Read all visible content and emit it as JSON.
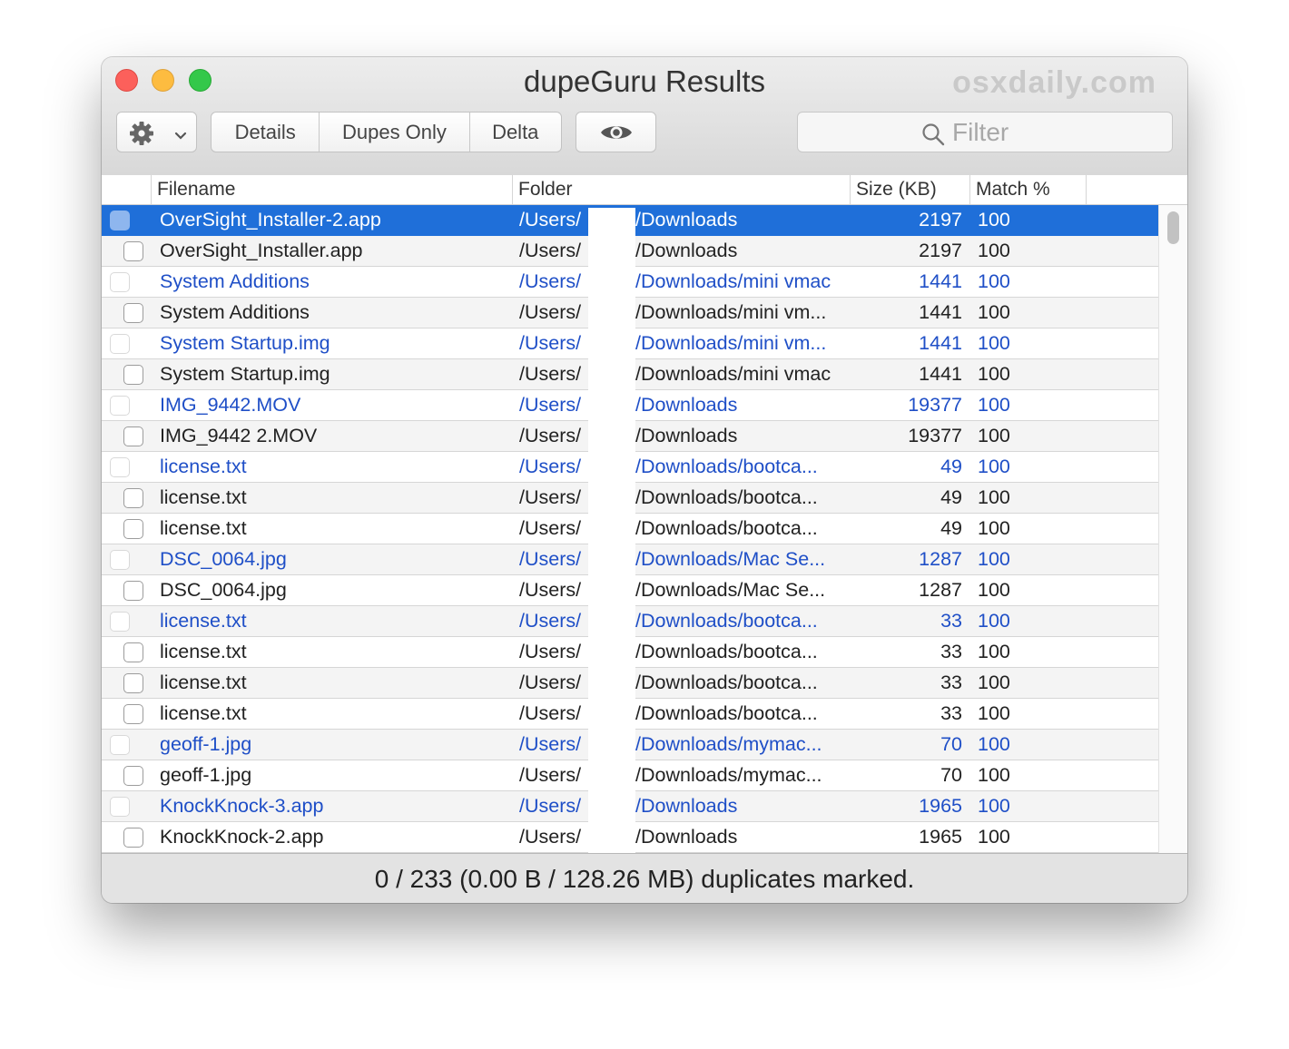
{
  "window": {
    "title": "dupeGuru Results",
    "watermark": "osxdaily.com"
  },
  "toolbar": {
    "gear_icon": "gear-icon",
    "view_buttons": [
      {
        "label": "Details"
      },
      {
        "label": "Dupes Only"
      },
      {
        "label": "Delta"
      }
    ],
    "preview_icon": "eye-icon",
    "filter_placeholder": "Filter"
  },
  "table": {
    "columns": [
      "Filename",
      "Folder",
      "Size (KB)",
      "Match %"
    ],
    "rows": [
      {
        "name": "OverSight_Installer-2.app",
        "folder_prefix": "/Users/",
        "folder_suffix": "/Downloads",
        "size": "2197",
        "match": "100"
      },
      {
        "name": "OverSight_Installer.app",
        "folder_prefix": "/Users/",
        "folder_suffix": "/Downloads",
        "size": "2197",
        "match": "100"
      },
      {
        "name": "System Additions",
        "folder_prefix": "/Users/",
        "folder_suffix": "/Downloads/mini vmac",
        "size": "1441",
        "match": "100"
      },
      {
        "name": "System Additions",
        "folder_prefix": "/Users/",
        "folder_suffix": "/Downloads/mini vm...",
        "size": "1441",
        "match": "100"
      },
      {
        "name": "System Startup.img",
        "folder_prefix": "/Users/",
        "folder_suffix": "/Downloads/mini vm...",
        "size": "1441",
        "match": "100"
      },
      {
        "name": "System Startup.img",
        "folder_prefix": "/Users/",
        "folder_suffix": "/Downloads/mini vmac",
        "size": "1441",
        "match": "100"
      },
      {
        "name": "IMG_9442.MOV",
        "folder_prefix": "/Users/",
        "folder_suffix": "/Downloads",
        "size": "19377",
        "match": "100"
      },
      {
        "name": "IMG_9442 2.MOV",
        "folder_prefix": "/Users/",
        "folder_suffix": "/Downloads",
        "size": "19377",
        "match": "100"
      },
      {
        "name": "license.txt",
        "folder_prefix": "/Users/",
        "folder_suffix": "/Downloads/bootca...",
        "size": "49",
        "match": "100"
      },
      {
        "name": "license.txt",
        "folder_prefix": "/Users/",
        "folder_suffix": "/Downloads/bootca...",
        "size": "49",
        "match": "100"
      },
      {
        "name": "license.txt",
        "folder_prefix": "/Users/",
        "folder_suffix": "/Downloads/bootca...",
        "size": "49",
        "match": "100"
      },
      {
        "name": "DSC_0064.jpg",
        "folder_prefix": "/Users/",
        "folder_suffix": "/Downloads/Mac Se...",
        "size": "1287",
        "match": "100"
      },
      {
        "name": "DSC_0064.jpg",
        "folder_prefix": "/Users/",
        "folder_suffix": "/Downloads/Mac Se...",
        "size": "1287",
        "match": "100"
      },
      {
        "name": "license.txt",
        "folder_prefix": "/Users/",
        "folder_suffix": "/Downloads/bootca...",
        "size": "33",
        "match": "100"
      },
      {
        "name": "license.txt",
        "folder_prefix": "/Users/",
        "folder_suffix": "/Downloads/bootca...",
        "size": "33",
        "match": "100"
      },
      {
        "name": "license.txt",
        "folder_prefix": "/Users/",
        "folder_suffix": "/Downloads/bootca...",
        "size": "33",
        "match": "100"
      },
      {
        "name": "license.txt",
        "folder_prefix": "/Users/",
        "folder_suffix": "/Downloads/bootca...",
        "size": "33",
        "match": "100"
      },
      {
        "name": "geoff-1.jpg",
        "folder_prefix": "/Users/",
        "folder_suffix": "/Downloads/mymac...",
        "size": "70",
        "match": "100"
      },
      {
        "name": "geoff-1.jpg",
        "folder_prefix": "/Users/",
        "folder_suffix": "/Downloads/mymac...",
        "size": "70",
        "match": "100"
      },
      {
        "name": "KnockKnock-3.app",
        "folder_prefix": "/Users/",
        "folder_suffix": "/Downloads",
        "size": "1965",
        "match": "100"
      },
      {
        "name": "KnockKnock-2.app",
        "folder_prefix": "/Users/",
        "folder_suffix": "/Downloads",
        "size": "1965",
        "match": "100"
      }
    ]
  },
  "status": {
    "text": "0 / 233 (0.00 B / 128.26 MB) duplicates marked."
  },
  "colors": {
    "selection": "#1f6fd9",
    "reference_text": "#1f4fc7"
  }
}
